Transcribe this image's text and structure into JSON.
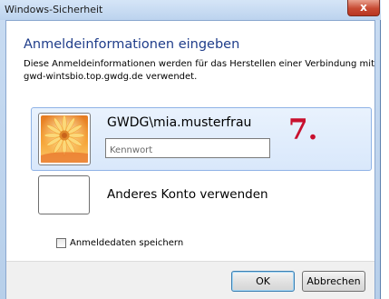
{
  "window": {
    "title": "Windows-Sicherheit",
    "close_label": "x"
  },
  "dialog": {
    "heading": "Anmeldeinformationen eingeben",
    "description": "Diese Anmeldeinformationen werden für das Herstellen einer Verbindung mit gwd-wintsbio.top.gwdg.de verwendet."
  },
  "account": {
    "username": "GWDG\\mia.musterfrau",
    "password_placeholder": "Kennwort",
    "annotation": "7."
  },
  "other_account": {
    "label": "Anderes Konto verwenden"
  },
  "remember": {
    "label": "Anmeldedaten speichern",
    "checked": false
  },
  "buttons": {
    "ok": "OK",
    "cancel": "Abbrechen"
  },
  "colors": {
    "heading": "#1f3d8a",
    "annotation": "#c8102e",
    "tile_border": "#8fb3e6"
  }
}
